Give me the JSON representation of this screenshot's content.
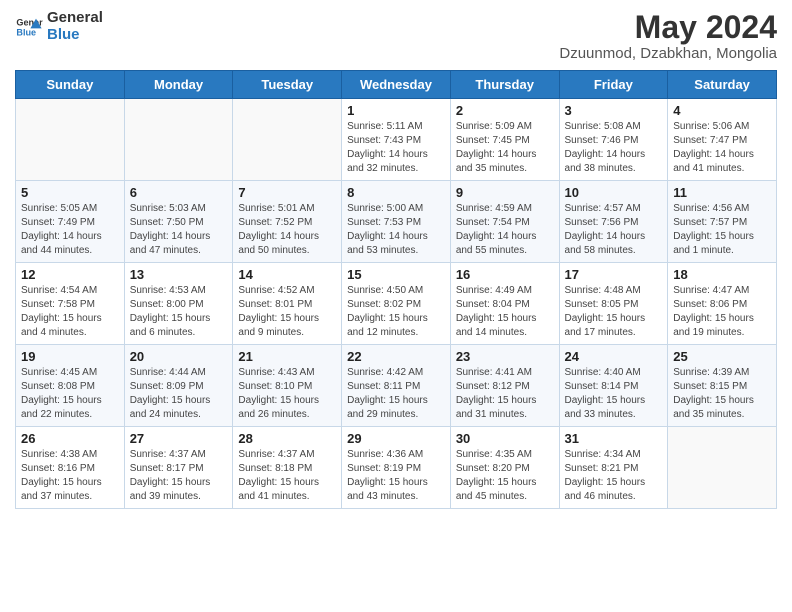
{
  "logo": {
    "line1": "General",
    "line2": "Blue"
  },
  "title": "May 2024",
  "subtitle": "Dzuunmod, Dzabkhan, Mongolia",
  "days_of_week": [
    "Sunday",
    "Monday",
    "Tuesday",
    "Wednesday",
    "Thursday",
    "Friday",
    "Saturday"
  ],
  "weeks": [
    [
      {
        "day": "",
        "info": ""
      },
      {
        "day": "",
        "info": ""
      },
      {
        "day": "",
        "info": ""
      },
      {
        "day": "1",
        "info": "Sunrise: 5:11 AM\nSunset: 7:43 PM\nDaylight: 14 hours\nand 32 minutes."
      },
      {
        "day": "2",
        "info": "Sunrise: 5:09 AM\nSunset: 7:45 PM\nDaylight: 14 hours\nand 35 minutes."
      },
      {
        "day": "3",
        "info": "Sunrise: 5:08 AM\nSunset: 7:46 PM\nDaylight: 14 hours\nand 38 minutes."
      },
      {
        "day": "4",
        "info": "Sunrise: 5:06 AM\nSunset: 7:47 PM\nDaylight: 14 hours\nand 41 minutes."
      }
    ],
    [
      {
        "day": "5",
        "info": "Sunrise: 5:05 AM\nSunset: 7:49 PM\nDaylight: 14 hours\nand 44 minutes."
      },
      {
        "day": "6",
        "info": "Sunrise: 5:03 AM\nSunset: 7:50 PM\nDaylight: 14 hours\nand 47 minutes."
      },
      {
        "day": "7",
        "info": "Sunrise: 5:01 AM\nSunset: 7:52 PM\nDaylight: 14 hours\nand 50 minutes."
      },
      {
        "day": "8",
        "info": "Sunrise: 5:00 AM\nSunset: 7:53 PM\nDaylight: 14 hours\nand 53 minutes."
      },
      {
        "day": "9",
        "info": "Sunrise: 4:59 AM\nSunset: 7:54 PM\nDaylight: 14 hours\nand 55 minutes."
      },
      {
        "day": "10",
        "info": "Sunrise: 4:57 AM\nSunset: 7:56 PM\nDaylight: 14 hours\nand 58 minutes."
      },
      {
        "day": "11",
        "info": "Sunrise: 4:56 AM\nSunset: 7:57 PM\nDaylight: 15 hours\nand 1 minute."
      }
    ],
    [
      {
        "day": "12",
        "info": "Sunrise: 4:54 AM\nSunset: 7:58 PM\nDaylight: 15 hours\nand 4 minutes."
      },
      {
        "day": "13",
        "info": "Sunrise: 4:53 AM\nSunset: 8:00 PM\nDaylight: 15 hours\nand 6 minutes."
      },
      {
        "day": "14",
        "info": "Sunrise: 4:52 AM\nSunset: 8:01 PM\nDaylight: 15 hours\nand 9 minutes."
      },
      {
        "day": "15",
        "info": "Sunrise: 4:50 AM\nSunset: 8:02 PM\nDaylight: 15 hours\nand 12 minutes."
      },
      {
        "day": "16",
        "info": "Sunrise: 4:49 AM\nSunset: 8:04 PM\nDaylight: 15 hours\nand 14 minutes."
      },
      {
        "day": "17",
        "info": "Sunrise: 4:48 AM\nSunset: 8:05 PM\nDaylight: 15 hours\nand 17 minutes."
      },
      {
        "day": "18",
        "info": "Sunrise: 4:47 AM\nSunset: 8:06 PM\nDaylight: 15 hours\nand 19 minutes."
      }
    ],
    [
      {
        "day": "19",
        "info": "Sunrise: 4:45 AM\nSunset: 8:08 PM\nDaylight: 15 hours\nand 22 minutes."
      },
      {
        "day": "20",
        "info": "Sunrise: 4:44 AM\nSunset: 8:09 PM\nDaylight: 15 hours\nand 24 minutes."
      },
      {
        "day": "21",
        "info": "Sunrise: 4:43 AM\nSunset: 8:10 PM\nDaylight: 15 hours\nand 26 minutes."
      },
      {
        "day": "22",
        "info": "Sunrise: 4:42 AM\nSunset: 8:11 PM\nDaylight: 15 hours\nand 29 minutes."
      },
      {
        "day": "23",
        "info": "Sunrise: 4:41 AM\nSunset: 8:12 PM\nDaylight: 15 hours\nand 31 minutes."
      },
      {
        "day": "24",
        "info": "Sunrise: 4:40 AM\nSunset: 8:14 PM\nDaylight: 15 hours\nand 33 minutes."
      },
      {
        "day": "25",
        "info": "Sunrise: 4:39 AM\nSunset: 8:15 PM\nDaylight: 15 hours\nand 35 minutes."
      }
    ],
    [
      {
        "day": "26",
        "info": "Sunrise: 4:38 AM\nSunset: 8:16 PM\nDaylight: 15 hours\nand 37 minutes."
      },
      {
        "day": "27",
        "info": "Sunrise: 4:37 AM\nSunset: 8:17 PM\nDaylight: 15 hours\nand 39 minutes."
      },
      {
        "day": "28",
        "info": "Sunrise: 4:37 AM\nSunset: 8:18 PM\nDaylight: 15 hours\nand 41 minutes."
      },
      {
        "day": "29",
        "info": "Sunrise: 4:36 AM\nSunset: 8:19 PM\nDaylight: 15 hours\nand 43 minutes."
      },
      {
        "day": "30",
        "info": "Sunrise: 4:35 AM\nSunset: 8:20 PM\nDaylight: 15 hours\nand 45 minutes."
      },
      {
        "day": "31",
        "info": "Sunrise: 4:34 AM\nSunset: 8:21 PM\nDaylight: 15 hours\nand 46 minutes."
      },
      {
        "day": "",
        "info": ""
      }
    ]
  ]
}
